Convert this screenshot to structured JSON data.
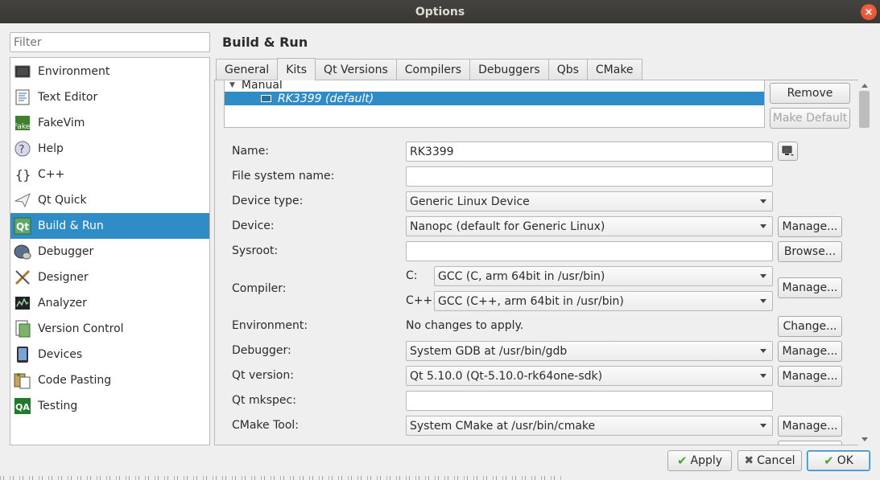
{
  "window": {
    "title": "Options",
    "close_glyph": "×"
  },
  "filter": {
    "placeholder": "Filter"
  },
  "sidebar": {
    "items": [
      {
        "label": "Environment",
        "icon": "environment-icon"
      },
      {
        "label": "Text Editor",
        "icon": "text-editor-icon"
      },
      {
        "label": "FakeVim",
        "icon": "fakevim-icon"
      },
      {
        "label": "Help",
        "icon": "help-icon"
      },
      {
        "label": "C++",
        "icon": "cpp-icon"
      },
      {
        "label": "Qt Quick",
        "icon": "qt-quick-icon"
      },
      {
        "label": "Build & Run",
        "icon": "build-run-icon",
        "selected": true
      },
      {
        "label": "Debugger",
        "icon": "debugger-icon"
      },
      {
        "label": "Designer",
        "icon": "designer-icon"
      },
      {
        "label": "Analyzer",
        "icon": "analyzer-icon"
      },
      {
        "label": "Version Control",
        "icon": "version-control-icon"
      },
      {
        "label": "Devices",
        "icon": "devices-icon"
      },
      {
        "label": "Code Pasting",
        "icon": "code-pasting-icon"
      },
      {
        "label": "Testing",
        "icon": "testing-icon"
      }
    ],
    "icon_glyphs": {
      "fake": "Fake",
      "help": "?",
      "cpp": "{}",
      "qa": "QA",
      "qt": "Qt"
    }
  },
  "main": {
    "title": "Build & Run",
    "tabs": [
      "General",
      "Kits",
      "Qt Versions",
      "Compilers",
      "Debuggers",
      "Qbs",
      "CMake"
    ],
    "active_tab": "Kits"
  },
  "kits": {
    "group": "Manual",
    "selected_kit": "RK3399 (default)",
    "remove_label": "Remove",
    "make_default_label": "Make Default"
  },
  "form": {
    "name": {
      "label": "Name:",
      "value": "RK3399"
    },
    "fs_name": {
      "label": "File system name:",
      "value": ""
    },
    "device_type": {
      "label": "Device type:",
      "value": "Generic Linux Device"
    },
    "device": {
      "label": "Device:",
      "value": "Nanopc (default for Generic Linux)",
      "button": "Manage..."
    },
    "sysroot": {
      "label": "Sysroot:",
      "value": "",
      "button": "Browse..."
    },
    "compiler": {
      "label": "Compiler:",
      "c_label": "C:",
      "c_value": "GCC (C, arm 64bit in /usr/bin)",
      "cpp_label": "C++:",
      "cpp_value": "GCC (C++, arm 64bit in /usr/bin)",
      "button": "Manage..."
    },
    "environment": {
      "label": "Environment:",
      "value": "No changes to apply.",
      "button": "Change..."
    },
    "debugger": {
      "label": "Debugger:",
      "value": "System GDB at /usr/bin/gdb",
      "button": "Manage..."
    },
    "qt_version": {
      "label": "Qt version:",
      "value": "Qt 5.10.0 (Qt-5.10.0-rk64one-sdk)",
      "button": "Manage..."
    },
    "qt_mkspec": {
      "label": "Qt mkspec:",
      "value": ""
    },
    "cmake_tool": {
      "label": "CMake Tool:",
      "value": "System CMake at /usr/bin/cmake",
      "button": "Manage..."
    }
  },
  "footer": {
    "apply": "Apply",
    "cancel": "Cancel",
    "ok": "OK",
    "check_glyph": "✔",
    "cross_glyph": "✖"
  },
  "colors": {
    "selection": "#308cc6",
    "titlebar": "#3c3b37",
    "close": "#e9542f"
  }
}
